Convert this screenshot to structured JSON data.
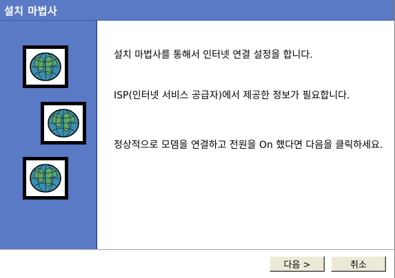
{
  "window": {
    "title": "설치 마법사"
  },
  "content": {
    "paragraphs": [
      "설치 마법사를 통해서 인터넷 연결 설정을 합니다.",
      "ISP(인터넷 서비스 공급자)에서 제공한 정보가 필요합니다.",
      "정상적으로 모뎀을 연결하고 전원을 On 했다면 다음을 클릭하세요."
    ]
  },
  "buttons": {
    "next_label": "다음 >",
    "cancel_label": "취소"
  },
  "colors": {
    "accent": "#5a7ac6",
    "ocean": "#3d8fb0",
    "land": "#5fa86b"
  },
  "icons": [
    "globe-icon",
    "globe-icon",
    "globe-icon"
  ]
}
